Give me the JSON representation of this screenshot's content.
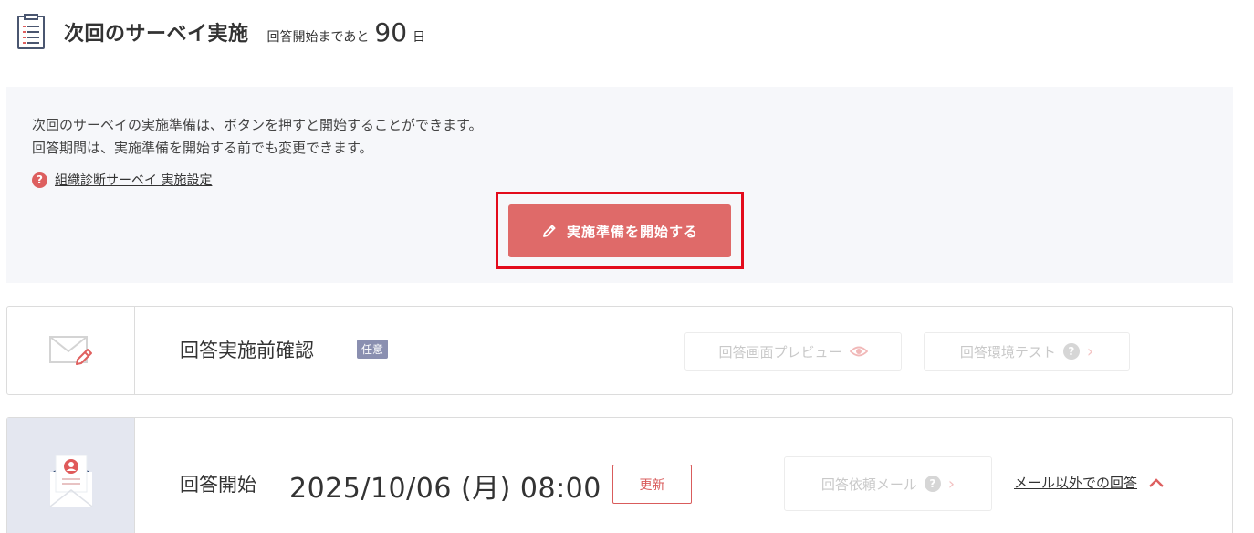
{
  "header": {
    "title": "次回のサーベイ実施",
    "countdown_prefix": "回答開始まであと",
    "countdown_days": "90",
    "countdown_suffix": "日"
  },
  "info": {
    "line1": "次回のサーベイの実施準備は、ボタンを押すと開始することができます。",
    "line2": "回答期間は、実施準備を開始する前でも変更できます。",
    "help_mark": "?",
    "help_link": "組織診断サーベイ 実施設定",
    "start_button": "実施準備を開始する"
  },
  "pre_check": {
    "title": "回答実施前確認",
    "badge": "任意",
    "preview_button": "回答画面プレビュー",
    "env_test_button": "回答環境テスト",
    "help_mark": "?",
    "chevron": "›"
  },
  "start_section": {
    "title": "回答開始",
    "datetime": "2025/10/06 (月) 08:00",
    "update_button": "更新",
    "request_mail_button": "回答依頼メール",
    "help_mark": "?",
    "chevron": "›",
    "other_link": "メール以外での回答"
  },
  "colors": {
    "accent": "#df6a69",
    "highlight_border": "#e30b1c",
    "panel_bg": "#f6f7fa",
    "badge_bg": "#8a8fb0"
  },
  "icons": {
    "doc": "document-list-icon",
    "pencil": "pencil-icon",
    "help": "question-circle-icon",
    "envelope_pen": "envelope-pen-icon",
    "eye": "eye-icon",
    "envelope_person": "envelope-person-icon",
    "chevron_up": "chevron-up-icon"
  }
}
